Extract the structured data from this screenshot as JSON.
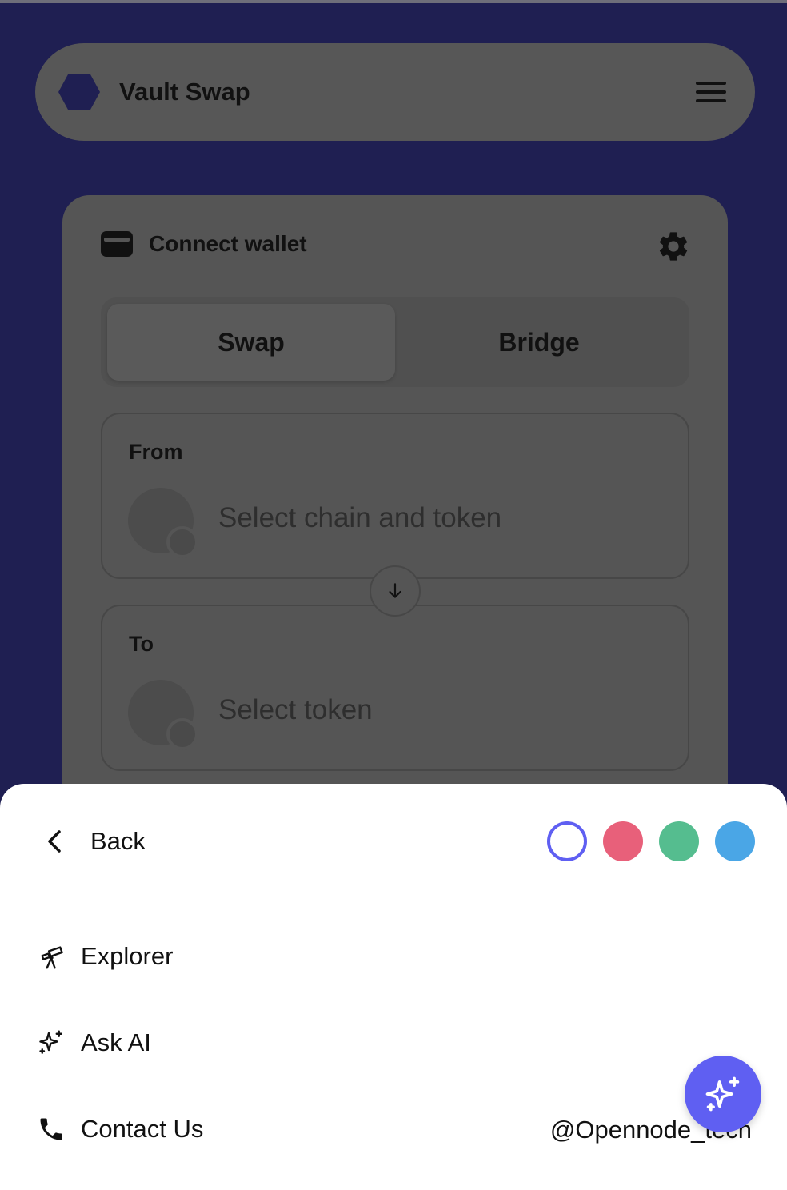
{
  "header": {
    "brand": "Vault Swap",
    "menu_icon": "hamburger-menu-icon"
  },
  "card": {
    "wallet_label": "Connect wallet",
    "tabs": [
      {
        "label": "Swap",
        "active": true
      },
      {
        "label": "Bridge",
        "active": false
      }
    ],
    "from": {
      "label": "From",
      "placeholder": "Select chain and token"
    },
    "to": {
      "label": "To",
      "placeholder": "Select token"
    }
  },
  "sheet": {
    "back_label": "Back",
    "theme_colors": [
      "#5f5ff2",
      "#e8607a",
      "#55bd8f",
      "#4aa6e6"
    ],
    "menu": [
      {
        "label": "Explorer",
        "icon": "telescope-icon"
      },
      {
        "label": "Ask AI",
        "icon": "sparkles-icon"
      },
      {
        "label": "Contact Us",
        "icon": "phone-icon"
      }
    ],
    "contact_handle": "@Opennode_tech"
  },
  "colors": {
    "background": "#1f1f52",
    "accent": "#5f5ff2"
  }
}
